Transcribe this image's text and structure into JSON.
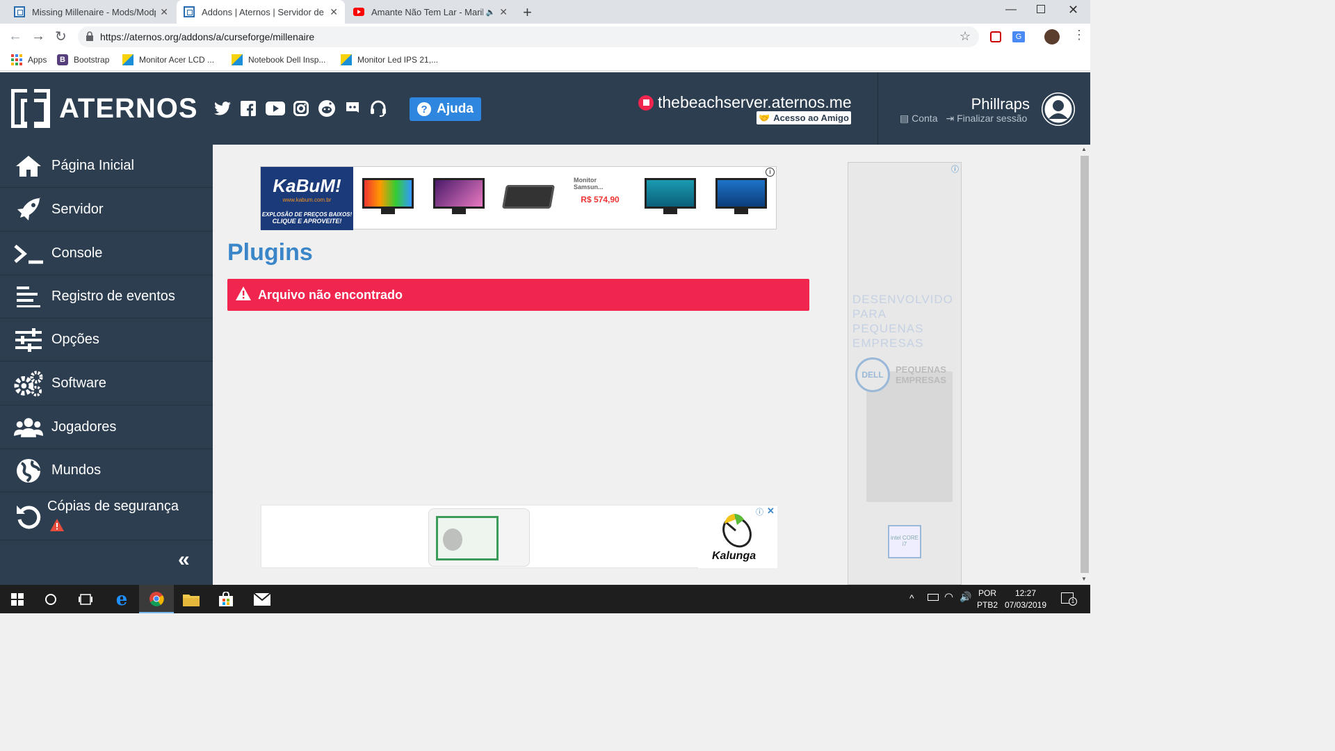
{
  "browser": {
    "tabs": [
      {
        "title": "Missing Millenaire - Mods/Modp",
        "favicon": "aternos-icon"
      },
      {
        "title": "Addons | Aternos | Servidor de M",
        "favicon": "aternos-icon"
      },
      {
        "title": "Amante Não Tem Lar - Marili",
        "favicon": "youtube-icon"
      }
    ],
    "url": "https://aternos.org/addons/a/curseforge/millenaire",
    "bookmarks": [
      {
        "label": "Apps"
      },
      {
        "label": "Bootstrap"
      },
      {
        "label": "Monitor Acer LCD ..."
      },
      {
        "label": "Notebook Dell Insp..."
      },
      {
        "label": "Monitor Led IPS 21,..."
      }
    ]
  },
  "header": {
    "logo_text": "ATERNOS",
    "help_label": "Ajuda",
    "server_name": "thebeachserver.aternos.me",
    "friend_access": "Acesso ao Amigo",
    "username": "Phillraps",
    "account_label": "Conta",
    "logout_label": "Finalizar sessão"
  },
  "sidebar": {
    "items": [
      {
        "label": "Página Inicial"
      },
      {
        "label": "Servidor"
      },
      {
        "label": "Console"
      },
      {
        "label": "Registro de eventos"
      },
      {
        "label": "Opções"
      },
      {
        "label": "Software"
      },
      {
        "label": "Jogadores"
      },
      {
        "label": "Mundos"
      },
      {
        "label": "Cópias de segurança"
      }
    ],
    "collapse_label": "«"
  },
  "main": {
    "title": "Plugins",
    "alert_text": "Arquivo não encontrado"
  },
  "ads": {
    "kabum_logo": "KaBuM!",
    "kabum_site": "www.kabum.com.br",
    "kabum_slogan_1": "EXPLOSÃO DE PREÇOS BAIXOS!",
    "kabum_slogan_2": "CLIQUE E APROVEITE!",
    "product_name": "Monitor Samsun...",
    "product_price": "R$ 574,90",
    "kalunga": "Kalunga",
    "dell_headline": "DESENVOLVIDO PARA PEQUENAS EMPRESAS",
    "dell_sub": "PEQUENAS EMPRESAS",
    "dell_logo": "DELL",
    "intel_badge": "intel CORE i7"
  },
  "taskbar": {
    "lang_1": "POR",
    "lang_2": "PTB2",
    "time": "12:27",
    "date": "07/03/2019",
    "notifications": "1"
  },
  "colors": {
    "brand_dark": "#2c3e50",
    "help_blue": "#2e86de",
    "alert_red": "#f0264f",
    "title_blue": "#3a86c8"
  }
}
